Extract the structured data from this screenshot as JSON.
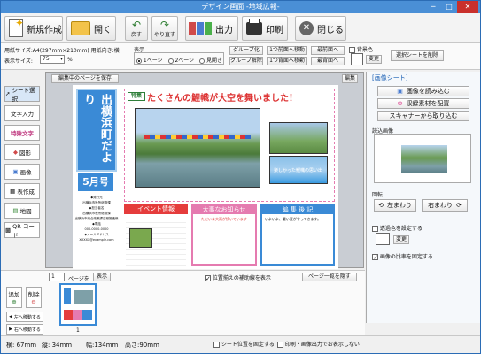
{
  "window": {
    "title": "デザイン画面 -地域広報-"
  },
  "toolbar": {
    "new": "新規作成",
    "open": "開く",
    "undo": "戻す",
    "redo": "やり直す",
    "export": "出力",
    "print": "印刷",
    "close": "閉じる"
  },
  "options": {
    "paper_size": "用紙サイズ:A4(297mm×210mm) 用紙向き:横",
    "display_size_label": "表示サイズ:",
    "display_size_value": "75",
    "percent": "%",
    "display_label": "表示",
    "view_options": [
      "1ページ",
      "2ページ",
      "見開き"
    ],
    "group": "グループ化",
    "ungroup": "グループ解除",
    "bring_front_one": "1つ前面へ移動",
    "send_back_one": "1つ背面へ移動",
    "bring_front": "最前面へ",
    "send_back": "最背面へ",
    "background_color": "背景色",
    "change": "変更",
    "delete_selected": "選択シートを削除"
  },
  "left_tools": [
    "シート選択",
    "文字入力",
    "特殊文字",
    "図形",
    "画像",
    "表作成",
    "地図",
    "QR コード"
  ],
  "canvas": {
    "save_page": "編集中のページを保存",
    "edit": "編集",
    "vertical_title": "出横浜町だより",
    "issue": "5月号",
    "headline_tag": "特集",
    "headline": "たくさんの鯉幟が大空を舞いました！",
    "caption": "楽しかった鯉幟の思い出",
    "event": "イベント情報",
    "notice": "大事なお知らせ",
    "editor": "編 集 後 記",
    "publisher_lines": [
      "◆発行元",
      "出横浜市役所総務課",
      "◆担当者名",
      "出横浜市役所総務課",
      "出横浜市総合政策課広報推進係",
      "◆電話",
      "000-0000-0000",
      "◆メールアドレス",
      "XXXXX@example.com"
    ],
    "notice_sub": "ただいま大雨が続いています",
    "editor_sub": "いよいよ、暑い夏がやってきます。"
  },
  "bottom": {
    "page_value": "1",
    "page_label": "ページを",
    "show": "表示",
    "alignment_lines": "位置揃えの補助線を表示",
    "page_list": "ページ一覧を隠す",
    "add": "追加",
    "delete": "削除",
    "move_left": "左へ移動する",
    "move_right": "右へ移動する",
    "thumb_label": "1"
  },
  "right": {
    "title": "[画像シート]",
    "load_image": "画像を読み込む",
    "clip_art": "収録素材を配置",
    "scanner": "スキャナーから取り込む",
    "loaded_image": "読込画像",
    "rotate": "回転",
    "rotate_left": "左まわり",
    "rotate_right": "右まわり",
    "transparent": "透過色を設定する",
    "change": "変更",
    "fix_ratio": "画像の比率を固定する"
  },
  "status": {
    "x": "横:  67mm",
    "y": "縦:  34mm",
    "width": "幅:134mm",
    "height": "高さ:90mm",
    "fix_sheet": "シート位置を固定する",
    "no_print": "印刷・画像出力でお表示しない"
  }
}
